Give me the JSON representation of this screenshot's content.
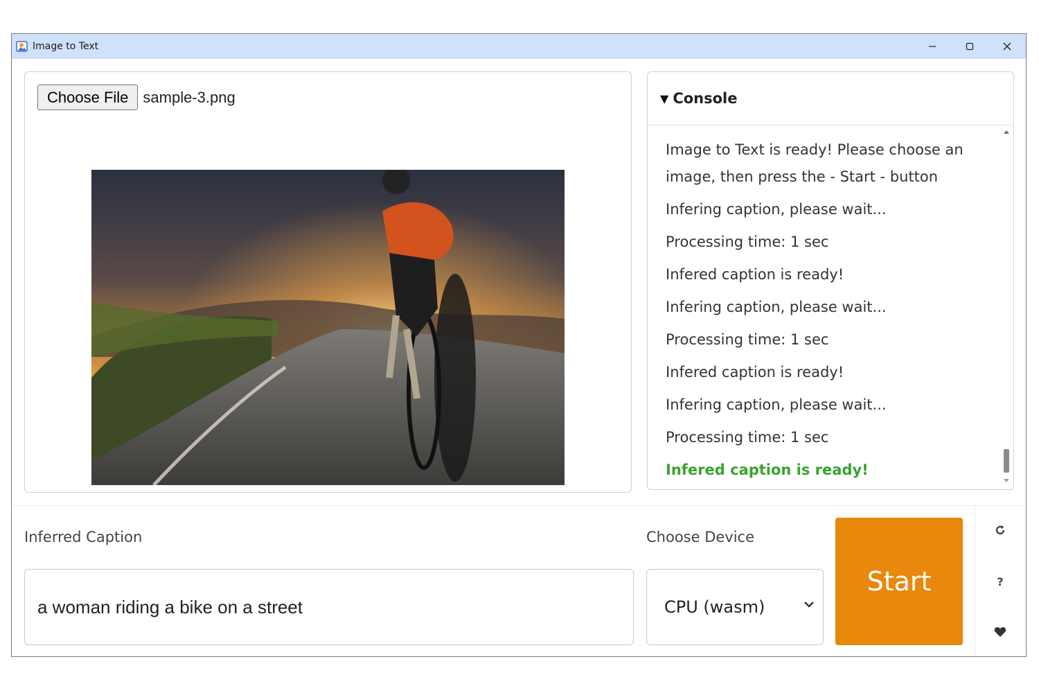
{
  "window": {
    "title": "Image to Text",
    "controls": [
      "minimize-icon",
      "maximize-icon",
      "close-icon"
    ]
  },
  "file_input": {
    "button_label": "Choose File",
    "file_name": "sample-3.png"
  },
  "console": {
    "expanded_icon": "triangle-down-icon",
    "title": "Console",
    "lines": [
      "Image to Text is ready! Please choose an image, then press the - Start - button",
      "Infering caption, please wait...",
      "Processing time: 1 sec",
      "Infered caption is ready!",
      "Infering caption, please wait...",
      "Processing time: 1 sec",
      "Infered caption is ready!",
      "Infering caption, please wait...",
      "Processing time: 1 sec",
      "Infered caption is ready!"
    ],
    "success_color": "#3aa22f"
  },
  "caption": {
    "label": "Inferred Caption",
    "value": "a woman riding a bike on a street"
  },
  "device": {
    "label": "Choose Device",
    "selected": "CPU (wasm)"
  },
  "start": {
    "label": "Start",
    "color": "#e8880c"
  },
  "side_icons": [
    "refresh-icon",
    "help-icon",
    "heart-icon"
  ]
}
